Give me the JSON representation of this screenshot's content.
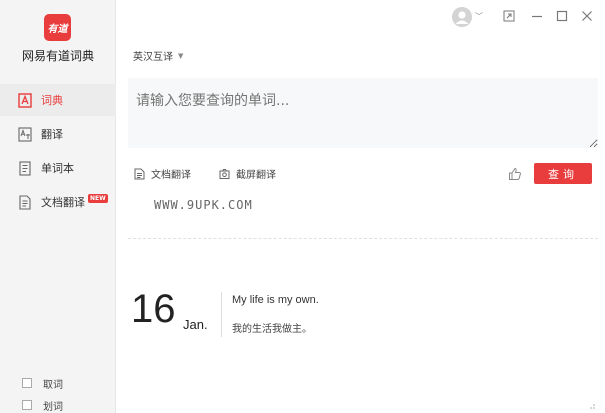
{
  "app": {
    "logo_text": "有道",
    "name": "网易有道词典"
  },
  "sidebar": {
    "items": [
      {
        "label": "词典",
        "active": true,
        "icon": "dict-icon"
      },
      {
        "label": "翻译",
        "active": false,
        "icon": "translate-icon"
      },
      {
        "label": "单词本",
        "active": false,
        "icon": "wordbook-icon"
      },
      {
        "label": "文档翻译",
        "active": false,
        "icon": "document-icon",
        "badge": "NEW"
      }
    ],
    "options": [
      {
        "label": "取词",
        "checked": false
      },
      {
        "label": "划词",
        "checked": false
      }
    ]
  },
  "main": {
    "lang_select": "英汉互译",
    "search_placeholder": "请输入您要查询的单词...",
    "tools": [
      {
        "label": "文档翻译",
        "icon": "document-icon"
      },
      {
        "label": "截屏翻译",
        "icon": "screenshot-icon"
      }
    ],
    "search_button": "查询",
    "watermark": "WWW.9UPK.COM"
  },
  "daily": {
    "day": "16",
    "month": "Jan.",
    "quote_en": "My life is my own.",
    "quote_zh": "我的生活我做主。"
  },
  "colors": {
    "accent": "#e93c3c",
    "sidebar_bg": "#f4f4f4",
    "search_bg": "#f7f8f9"
  }
}
